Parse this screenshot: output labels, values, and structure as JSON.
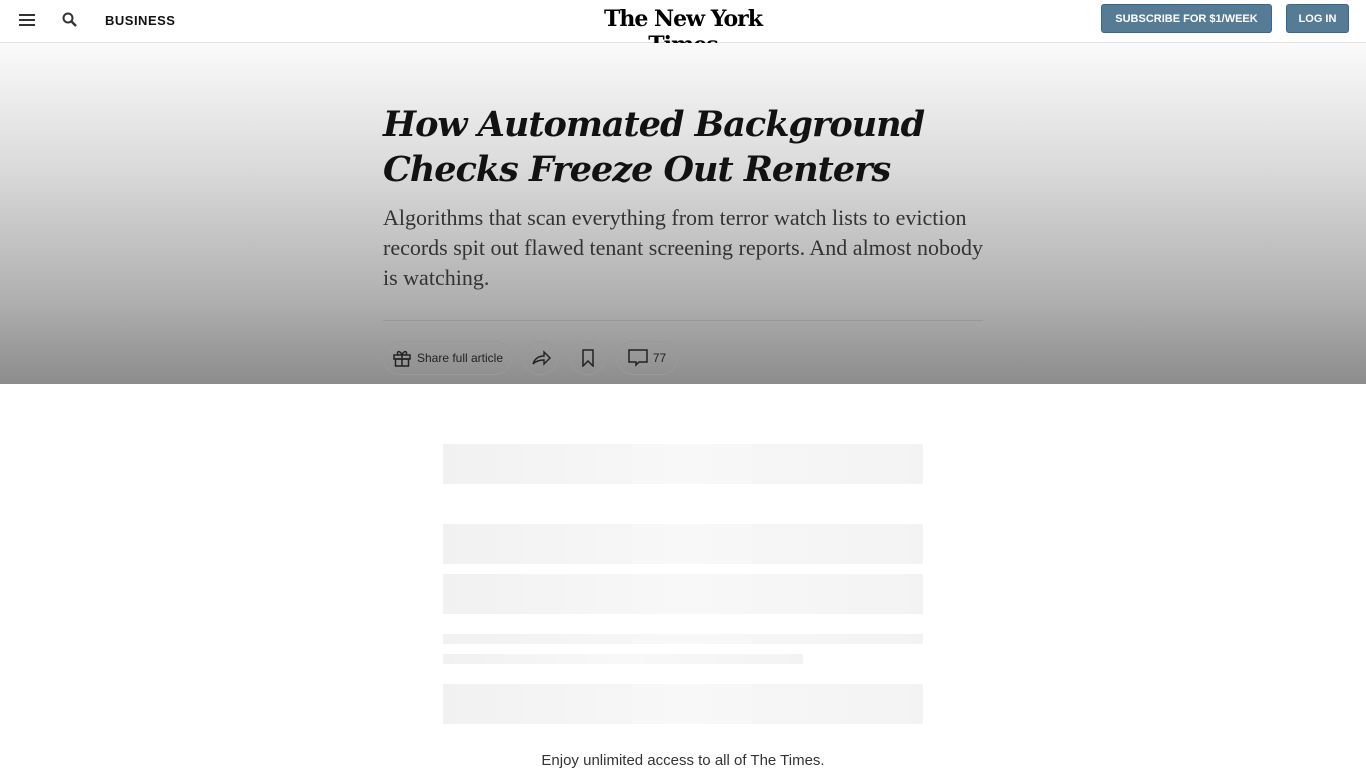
{
  "header": {
    "section": "BUSINESS",
    "logo": "The New York Times",
    "subscribe": "SUBSCRIBE FOR $1/WEEK",
    "login": "LOG IN",
    "accent": "#567b95"
  },
  "article": {
    "headline": "How Automated Background Checks Freeze Out Renters",
    "summary": "Algorithms that scan everything from terror watch lists to eviction records spit out flawed tenant screening reports. And almost nobody is watching.",
    "share_label": "Share full article",
    "comments": "77"
  },
  "paywall": {
    "message": "Enjoy unlimited access to all of The Times."
  }
}
